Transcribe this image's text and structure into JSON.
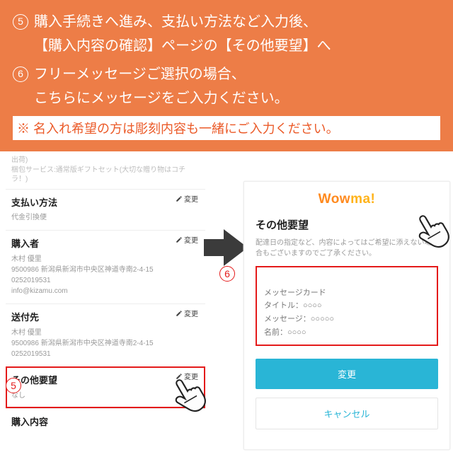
{
  "banner": {
    "step5_num": "5",
    "step5_text": "購入手続きへ進み、支払い方法など入力後、\n【購入内容の確認】ページの【その他要望】へ",
    "step6_num": "6",
    "step6_text": "フリーメッセージご選択の場合、\nこちらにメッセージをご入力ください。",
    "note": "※ 名入れ希望の方は彫刻内容も一緒にご入力ください。"
  },
  "left": {
    "crumb": "出荷)\n梱包サービス:通常版ギフトセット(大切な贈り物はコチラ！)",
    "pay_h": "支払い方法",
    "pay_d": "代金引換便",
    "buyer_h": "購入者",
    "buyer_d": "木村 優里\n9500986  新潟県新潟市中央区神道寺南2-4-15\n0252019531\ninfo@kizamu.com",
    "ship_h": "送付先",
    "ship_d": "木村 優里\n9500986  新潟県新潟市中央区神道寺南2-4-15\n0252019531",
    "other_h": "その他要望",
    "other_d": "なし",
    "content_h": "購入内容",
    "change": "変更"
  },
  "right": {
    "brand_a": "Wow",
    "brand_b": "ma!",
    "title": "その他要望",
    "hint": "配達日の指定など、内容によってはご希望に添えない場合もございますのでご了承ください。",
    "msg": "メッセージカード\nタイトル：○○○○\nメッセージ：○○○○○\n名前：○○○○",
    "btn_change": "変更",
    "btn_cancel": "キャンセル"
  },
  "tags": {
    "five": "5",
    "six": "6"
  }
}
